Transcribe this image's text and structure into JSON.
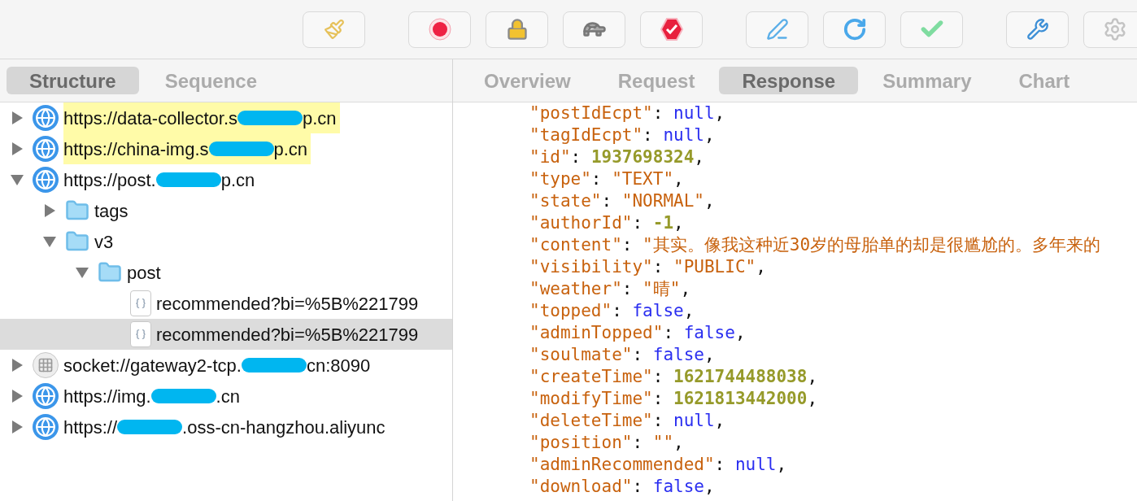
{
  "left_tabs": [
    {
      "label": "Structure",
      "selected": true
    },
    {
      "label": "Sequence",
      "selected": false
    }
  ],
  "right_tabs": [
    {
      "label": "Overview",
      "selected": false
    },
    {
      "label": "Request",
      "selected": false
    },
    {
      "label": "Response",
      "selected": true
    },
    {
      "label": "Summary",
      "selected": false
    },
    {
      "label": "Chart",
      "selected": false
    }
  ],
  "tree": [
    {
      "kind": "host",
      "start": "https://data-collector.s",
      "end": "p.cn",
      "highlighted": true,
      "selected": false,
      "expanded": false
    },
    {
      "kind": "host",
      "start": "https://china-img.s",
      "end": "p.cn",
      "highlighted": true,
      "selected": false,
      "expanded": false
    },
    {
      "kind": "host",
      "start": "https://post.",
      "end": "p.cn",
      "highlighted": false,
      "selected": false,
      "expanded": true,
      "children": [
        {
          "kind": "folder",
          "start": "tags",
          "highlighted": false,
          "selected": false,
          "expanded": false
        },
        {
          "kind": "folder",
          "start": "v3",
          "highlighted": false,
          "selected": false,
          "expanded": true,
          "children": [
            {
              "kind": "folder",
              "start": "post",
              "highlighted": false,
              "selected": false,
              "expanded": true,
              "children": [
                {
                  "kind": "file",
                  "start": "recommended?bi=%5B%221799",
                  "highlighted": false,
                  "selected": false
                },
                {
                  "kind": "file",
                  "start": "recommended?bi=%5B%221799",
                  "highlighted": false,
                  "selected": true
                }
              ]
            }
          ]
        }
      ]
    },
    {
      "kind": "socket",
      "start": "socket://gateway2-tcp.",
      "end": "cn:8090",
      "highlighted": false,
      "selected": false,
      "expanded": false
    },
    {
      "kind": "host",
      "start": "https://img.",
      "end": ".cn",
      "highlighted": false,
      "selected": false,
      "expanded": false
    },
    {
      "kind": "host",
      "start": "https://",
      "end": ".oss-cn-hangzhou.aliyunc",
      "highlighted": false,
      "selected": false,
      "expanded": false
    }
  ],
  "json_lines": [
    {
      "key": "\"postIdEcpt\"",
      "value": "null",
      "kind": "literal",
      "comma": ","
    },
    {
      "key": "\"tagIdEcpt\"",
      "value": "null",
      "kind": "literal",
      "comma": ","
    },
    {
      "key": "\"id\"",
      "value": "1937698324",
      "kind": "number",
      "comma": ","
    },
    {
      "key": "\"type\"",
      "value": "\"TEXT\"",
      "kind": "string",
      "comma": ","
    },
    {
      "key": "\"state\"",
      "value": "\"NORMAL\"",
      "kind": "string",
      "comma": ","
    },
    {
      "key": "\"authorId\"",
      "value": "-1",
      "kind": "number",
      "comma": ","
    },
    {
      "key": "\"content\"",
      "value": "\"其实。像我这种近30岁的母胎单的却是很尴尬的。多年来的",
      "kind": "string"
    },
    {
      "key": "\"visibility\"",
      "value": "\"PUBLIC\"",
      "kind": "string",
      "comma": ","
    },
    {
      "key": "\"weather\"",
      "value": "\"晴\"",
      "kind": "string",
      "comma": ","
    },
    {
      "key": "\"topped\"",
      "value": "false",
      "kind": "literal",
      "comma": ","
    },
    {
      "key": "\"adminTopped\"",
      "value": "false",
      "kind": "literal",
      "comma": ","
    },
    {
      "key": "\"soulmate\"",
      "value": "false",
      "kind": "literal",
      "comma": ","
    },
    {
      "key": "\"createTime\"",
      "value": "1621744488038",
      "kind": "number",
      "comma": ","
    },
    {
      "key": "\"modifyTime\"",
      "value": "1621813442000",
      "kind": "number",
      "comma": ","
    },
    {
      "key": "\"deleteTime\"",
      "value": "null",
      "kind": "literal",
      "comma": ","
    },
    {
      "key": "\"position\"",
      "value": "\"\"",
      "kind": "string",
      "comma": ","
    },
    {
      "key": "\"adminRecommended\"",
      "value": "null",
      "kind": "literal",
      "comma": ","
    },
    {
      "key": "\"download\"",
      "value": "false",
      "kind": "literal",
      "comma": ","
    }
  ],
  "punct": {
    "colon": ":"
  }
}
